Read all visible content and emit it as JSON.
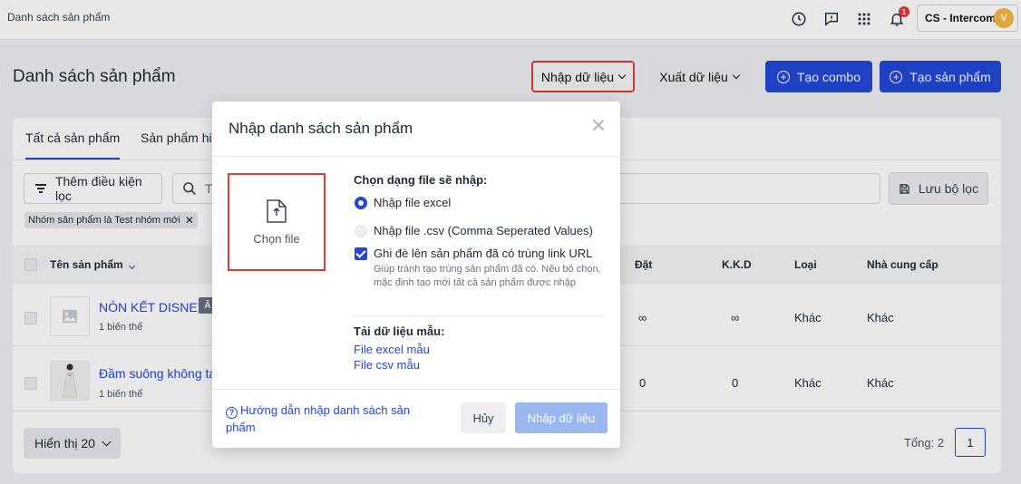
{
  "topbar": {
    "breadcrumb": "Danh sách sản phẩm",
    "notification_count": "1",
    "account_name": "CS - Intercom",
    "avatar_initial": "V",
    "icons": [
      "history-icon",
      "feedback-icon",
      "apps-grid-icon",
      "bell-icon"
    ]
  },
  "header": {
    "title": "Danh sách sản phẩm",
    "import_label": "Nhập dữ liệu",
    "export_label": "Xuất dữ liệu",
    "create_combo_label": "Tạo combo",
    "create_product_label": "Tạo sản phẩm"
  },
  "tabs": [
    "Tất cả sản phẩm",
    "Sản phẩm hiể"
  ],
  "filter": {
    "add_condition_label": "Thêm điều kiện lọc",
    "search_placeholder": "T",
    "save_filter_label": "Lưu bộ lọc",
    "active_chip": "Nhóm sản phẩm là Test nhóm mới"
  },
  "table": {
    "columns": {
      "name": "Tên sản phẩm",
      "ordered": "Đặt",
      "kkd": "K.K.D",
      "type": "Loại",
      "supplier": "Nhà cung cấp"
    },
    "rows": [
      {
        "name": "NÓN KẾT DISNEY",
        "badge": "Ă",
        "variants": "1 biến thể",
        "ordered": "∞",
        "kkd": "∞",
        "type": "Khác",
        "supplier": "Khác"
      },
      {
        "name": "Đầm suông không tay",
        "variants": "1 biến thể",
        "ordered": "0",
        "kkd": "0",
        "type": "Khác",
        "supplier": "Khác"
      }
    ]
  },
  "footer": {
    "show_label": "Hiển thị 20",
    "total_label": "Tổng: 2",
    "current_page": "1"
  },
  "modal": {
    "title": "Nhập danh sách sản phẩm",
    "choose_file_label": "Chọn file",
    "file_type_heading": "Chọn dạng file sẽ nhập:",
    "option_excel": "Nhập file excel",
    "option_csv": "Nhập file .csv (Comma Seperated Values)",
    "selected_option": "excel",
    "overwrite_label": "Ghi đè lên sản phẩm đã có trùng link URL",
    "overwrite_checked": true,
    "overwrite_hint": "Giúp tránh tạo trùng sản phẩm đã có. Nếu bỏ chọn, mặc định tạo mới tất cả sản phẩm được nhập",
    "sample_heading": "Tải dữ liệu mẫu:",
    "sample_excel": "File excel mẫu",
    "sample_csv": "File csv mẫu",
    "guide_link": "Hướng dẫn nhập danh sách sản phẩm",
    "cancel_label": "Hủy",
    "submit_label": "Nhập dữ liệu"
  },
  "colors": {
    "primary": "#2447d6",
    "highlight_red": "#e53935",
    "submit_disabled": "#9bb8ee"
  }
}
